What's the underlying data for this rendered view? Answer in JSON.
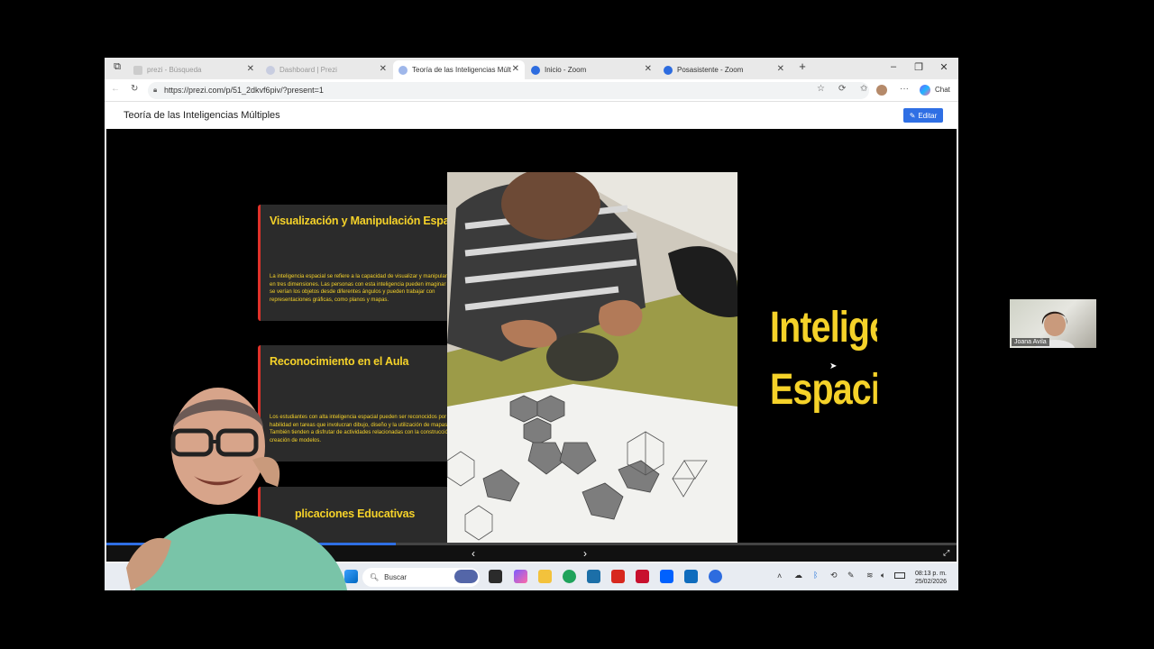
{
  "browser": {
    "tabs": [
      {
        "label": "prezi - Búsqueda",
        "active": false
      },
      {
        "label": "Dashboard | Prezi",
        "active": false
      },
      {
        "label": "Teoría de las Inteligencias Múltiples",
        "active": true
      },
      {
        "label": "Inicio - Zoom",
        "active": false
      },
      {
        "label": "Posasistente - Zoom",
        "active": false
      }
    ],
    "url": "https://prezi.com/p/51_2dkvf6piv/?present=1",
    "chat_label": "Chat"
  },
  "prezi": {
    "title": "Teoría de las Inteligencias Múltiples",
    "edit_label": "Editar",
    "progress_fraction": 0.34
  },
  "slide": {
    "cards": [
      {
        "heading": "Visualización y Manipulación Espacial",
        "body": "La inteligencia espacial se refiere a la capacidad de visualizar y manipular objetos en tres dimensiones. Las personas con esta inteligencia pueden imaginar cómo se verían los objetos desde diferentes ángulos y pueden trabajar con representaciones gráficas, como planos y mapas."
      },
      {
        "heading": "Reconocimiento en el Aula",
        "body": "Los estudiantes con alta inteligencia espacial pueden ser reconocidos por su habilidad en tareas que involucran dibujo, diseño y la utilización de mapas. También tienden a disfrutar de actividades relacionadas con la construcción o la creación de modelos."
      },
      {
        "heading": "plicaciones Educativas",
        "body": ""
      }
    ],
    "big_title_line1": "Inteligen",
    "big_title_line2": "Espacia"
  },
  "taskbar": {
    "search_placeholder": "Buscar",
    "time": "08:13 p. m.",
    "date": "25/02/2026"
  },
  "participants": {
    "joana_name": "Joana Avila"
  },
  "colors": {
    "accent_yellow": "#f5d229",
    "card_bar_red": "#e0322a",
    "prezi_blue": "#2f6fe4"
  }
}
